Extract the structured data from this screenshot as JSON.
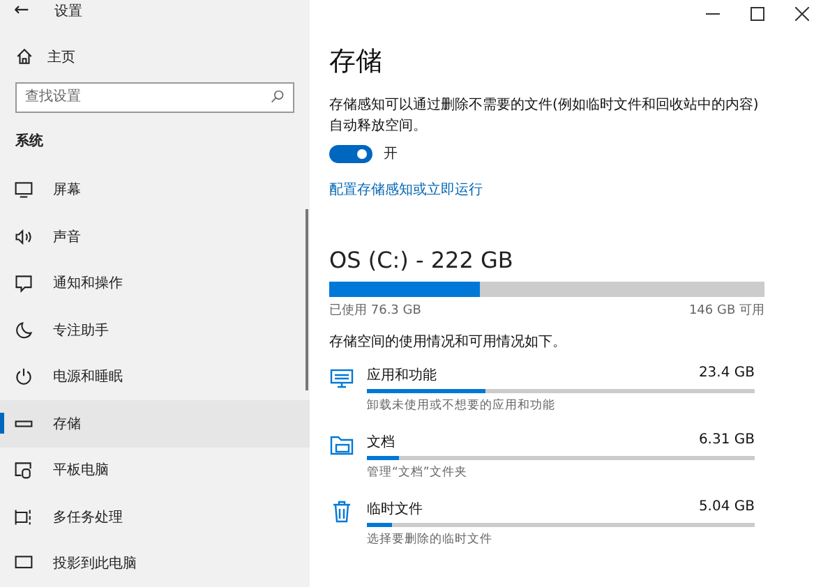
{
  "window": {
    "title": "设置",
    "back": "←"
  },
  "sidebar": {
    "home": "主页",
    "search": {
      "placeholder": "查找设置"
    },
    "section": "系统",
    "items": [
      {
        "label": "屏幕",
        "selected": false
      },
      {
        "label": "声音",
        "selected": false
      },
      {
        "label": "通知和操作",
        "selected": false
      },
      {
        "label": "专注助手",
        "selected": false
      },
      {
        "label": "电源和睡眠",
        "selected": false
      },
      {
        "label": "存储",
        "selected": true
      },
      {
        "label": "平板电脑",
        "selected": false
      },
      {
        "label": "多任务处理",
        "selected": false
      },
      {
        "label": "投影到此电脑",
        "selected": false
      }
    ]
  },
  "main": {
    "title": "存储",
    "description": "存储感知可以通过删除不需要的文件(例如临时文件和回收站中的内容)自动释放空间。",
    "toggle": {
      "on": true,
      "label": "开"
    },
    "link": "配置存储感知或立即运行",
    "drive": {
      "name": "OS (C:) - 222 GB",
      "level": 0.345,
      "used": "已使用 76.3 GB",
      "free": "146 GB 可用"
    },
    "summary": "存储空间的使用情况和可用情况如下。",
    "categories": [
      {
        "name": "应用和功能",
        "size": "23.4 GB",
        "level": 0.305,
        "hint": "卸载未使用或不想要的应用和功能"
      },
      {
        "name": "文档",
        "size": "6.31 GB",
        "level": 0.083,
        "hint": "管理“文档”文件夹"
      },
      {
        "name": "临时文件",
        "size": "5.04 GB",
        "level": 0.065,
        "hint": "选择要删除的临时文件"
      }
    ]
  }
}
